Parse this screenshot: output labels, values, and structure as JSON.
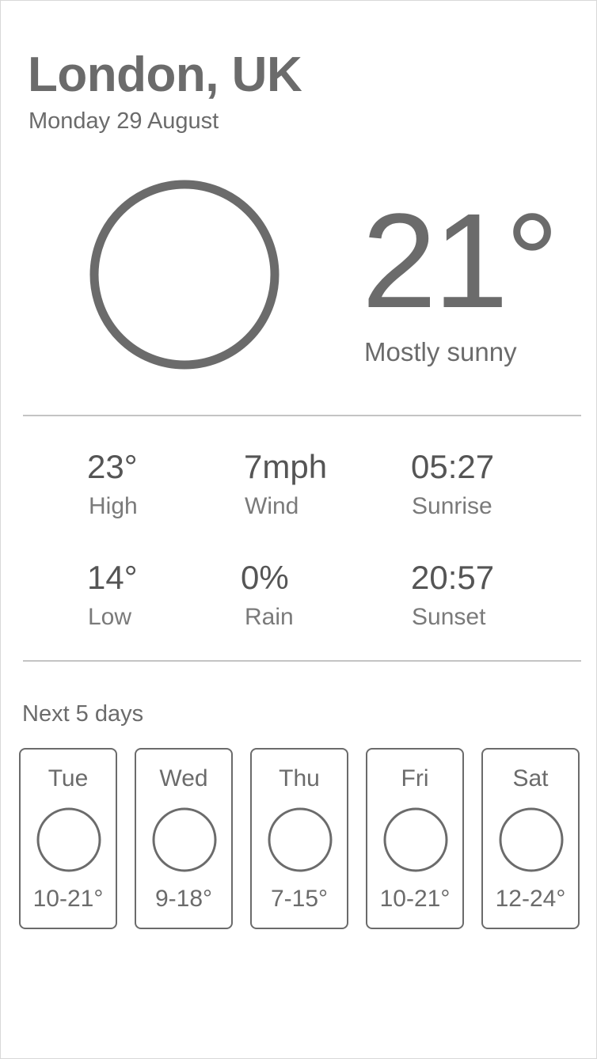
{
  "header": {
    "location": "London, UK",
    "date": "Monday 29 August"
  },
  "current": {
    "icon": "sun-icon",
    "temperature": "21°",
    "condition": "Mostly sunny"
  },
  "stats": [
    {
      "value": "23°",
      "label": "High"
    },
    {
      "value": "7mph",
      "label": "Wind"
    },
    {
      "value": "05:27",
      "label": "Sunrise"
    },
    {
      "value": "14°",
      "label": "Low"
    },
    {
      "value": "0%",
      "label": "Rain"
    },
    {
      "value": "20:57",
      "label": "Sunset"
    }
  ],
  "forecast": {
    "title": "Next 5 days",
    "days": [
      {
        "day": "Tue",
        "icon": "sun-icon",
        "range": "10-21°"
      },
      {
        "day": "Wed",
        "icon": "sun-icon",
        "range": "9-18°"
      },
      {
        "day": "Thu",
        "icon": "sun-icon",
        "range": "7-15°"
      },
      {
        "day": "Fri",
        "icon": "sun-icon",
        "range": "10-21°"
      },
      {
        "day": "Sat",
        "icon": "sun-icon",
        "range": "12-24°"
      }
    ]
  },
  "colors": {
    "text": "#6b6b6b",
    "divider": "#c4c4c4",
    "border": "#6b6b6b"
  }
}
